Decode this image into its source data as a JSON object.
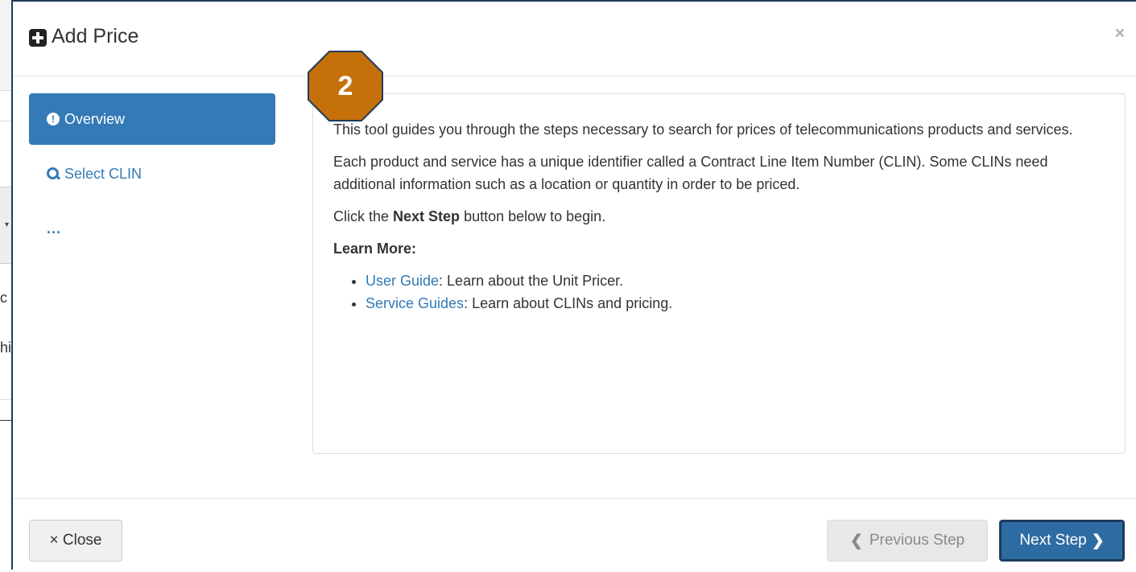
{
  "background": {
    "fragment_1": "c",
    "fragment_2": "hi"
  },
  "modal": {
    "title": "Add Price",
    "close_glyph": "×",
    "title_icon": "plus-square-icon"
  },
  "step_nav": {
    "items": [
      {
        "label": "Overview",
        "icon": "exclamation-circle-icon",
        "active": true
      },
      {
        "label": "Select CLIN",
        "icon": "search-icon",
        "active": false
      },
      {
        "label": "...",
        "icon": "",
        "active": false
      }
    ]
  },
  "badge": {
    "number": "2",
    "color": "#c5700a"
  },
  "content": {
    "p1": "This tool guides you through the steps necessary to search for prices of telecommunications products and services.",
    "p2": "Each product and service has a unique identifier called a Contract Line Item Number (CLIN). Some CLINs need additional information such as a location or quantity in order to be priced.",
    "p3_before": "Click the ",
    "p3_bold": "Next Step",
    "p3_after": " button below to begin.",
    "learn_more": "Learn More:",
    "links": [
      {
        "link_text": "User Guide",
        "rest": ": Learn about the Unit Pricer."
      },
      {
        "link_text": "Service Guides",
        "rest": ": Learn about CLINs and pricing."
      }
    ]
  },
  "footer": {
    "close_label": "× Close",
    "prev_label": "Previous Step",
    "next_label": "Next Step"
  },
  "colors": {
    "primary": "#337ab7",
    "next_button": "#2d6ca2",
    "border_dark": "#1f3a5c"
  }
}
